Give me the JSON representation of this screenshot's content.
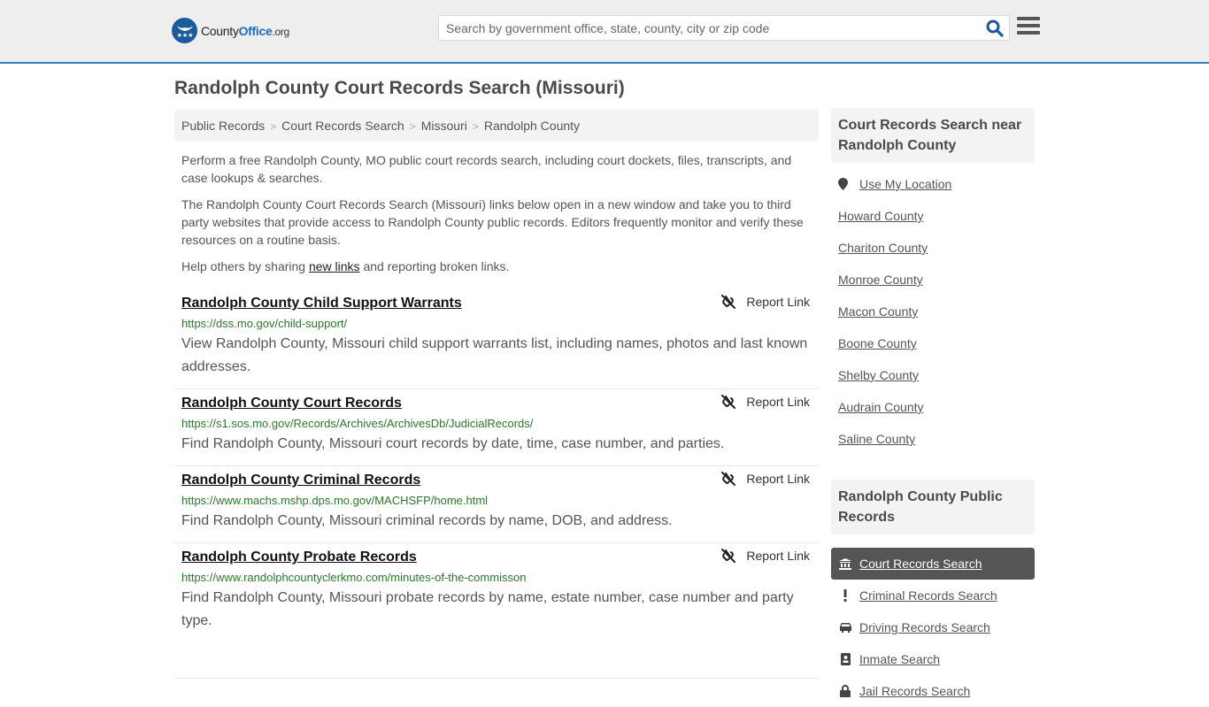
{
  "header": {
    "logo": {
      "name": "County",
      "name_bold": "Office",
      "tld": ".org"
    },
    "search": {
      "placeholder": "Search by government office, state, county, city or zip code",
      "value": ""
    },
    "colors": {
      "brand": "#1b6ac1",
      "header_border": "#3a7fb4"
    }
  },
  "page": {
    "title": "Randolph County Court Records Search (Missouri)"
  },
  "breadcrumb": [
    {
      "label": "Public Records"
    },
    {
      "label": "Court Records Search"
    },
    {
      "label": "Missouri"
    },
    {
      "label": "Randolph County"
    }
  ],
  "intro": {
    "p1": "Perform a free Randolph County, MO public court records search, including court dockets, files, transcripts, and case lookups & searches.",
    "p2": "The Randolph County Court Records Search (Missouri) links below open in a new window and take you to third party websites that provide access to Randolph County public records. Editors frequently monitor and verify these resources on a routine basis.",
    "p3_before": "Help others by sharing ",
    "p3_link": "new links",
    "p3_after": " and reporting broken links."
  },
  "records": [
    {
      "title": "Randolph County Child Support Warrants",
      "url": "https://dss.mo.gov/child-support/",
      "description": "View Randolph County, Missouri child support warrants list, including names, photos and last known addresses.",
      "report_label": "Report Link"
    },
    {
      "title": "Randolph County Court Records",
      "url": "https://s1.sos.mo.gov/Records/Archives/ArchivesDb/JudicialRecords/",
      "description": "Find Randolph County, Missouri court records by date, time, case number, and parties.",
      "report_label": "Report Link"
    },
    {
      "title": "Randolph County Criminal Records",
      "url": "https://www.machs.mshp.dps.mo.gov/MACHSFP/home.html",
      "description": "Find Randolph County, Missouri criminal records by name, DOB, and address.",
      "report_label": "Report Link"
    },
    {
      "title": "Randolph County Probate Records",
      "url": "https://www.randolphcountyclerkmo.com/minutes-of-the-commisson",
      "description": "Find Randolph County, Missouri probate records by name, estate number, case number and party type.",
      "report_label": "Report Link"
    }
  ],
  "sidebar": {
    "near_heading": "Court Records Search near Randolph County",
    "use_location": "Use My Location",
    "near_counties": [
      "Howard County",
      "Chariton County",
      "Monroe County",
      "Macon County",
      "Boone County",
      "Shelby County",
      "Audrain County",
      "Saline County"
    ],
    "public_records_heading": "Randolph County Public Records",
    "public_records": [
      {
        "label": "Court Records Search",
        "icon": "courthouse-icon",
        "active": true
      },
      {
        "label": "Criminal Records Search",
        "icon": "exclamation-icon",
        "active": false
      },
      {
        "label": "Driving Records Search",
        "icon": "car-icon",
        "active": false
      },
      {
        "label": "Inmate Search",
        "icon": "id-badge-icon",
        "active": false
      },
      {
        "label": "Jail Records Search",
        "icon": "lock-icon",
        "active": false
      }
    ]
  }
}
